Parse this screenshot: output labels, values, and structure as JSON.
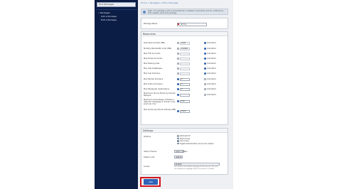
{
  "sidebar": {
    "search_placeholder": "Find Packages",
    "items": [
      "« Packages",
      "Add a Package",
      "Edit a Package"
    ]
  },
  "breadcrumb": [
    "Home",
    "Packages",
    "Edit a Package"
  ],
  "notice": "Note: If a package name is preceded by a reseller's username and an underscore, that reseller owns the package.",
  "package": {
    "label": "Package Name",
    "value": "Jimmy"
  },
  "resources": {
    "title": "Resources",
    "unlimited_label": "Unlimited",
    "rows": [
      {
        "label": "Disk Space Quota (MB)",
        "value": "1000"
      },
      {
        "label": "Monthly Bandwidth Limit (MB)",
        "value": "100000"
      },
      {
        "label": "Max FTP Accounts",
        "value": ""
      },
      {
        "label": "Max Email Accounts",
        "value": ""
      },
      {
        "label": "Max Mailing Lists",
        "value": ""
      },
      {
        "label": "Max SQL Databases",
        "value": ""
      },
      {
        "label": "Max Sub Domains",
        "value": ""
      },
      {
        "label": "Max Parked Domains",
        "value": "0"
      },
      {
        "label": "Max Addon Domains",
        "value": "0"
      },
      {
        "label": "Max Passenger Applications",
        "value": "0"
      },
      {
        "label": "Maximum Hourly Email by Domain Relayed",
        "value": ""
      },
      {
        "label": "Maximum percentage of failed or deferred messages a domain may send per hour",
        "value": "100"
      },
      {
        "label": "Max Quota per Email Address (MB)",
        "value": "1024"
      }
    ]
  },
  "settings": {
    "title": "Settings",
    "options_label": "Options",
    "options": [
      "Dedicated IP",
      "Shell Access",
      "CGI Access",
      "Digest Authentication at account creation"
    ],
    "theme_label": "cPanel Theme",
    "theme_value": "paper_lantern",
    "feature_list_label": "Feature List",
    "feature_list_value": "default",
    "locale_label": "Locale",
    "locale_value": "English",
    "locale_note": "This locale is the default language of the account. The user can change the language after the account is created."
  },
  "save_label": "Add",
  "colors": {
    "sidebar": "#0b1d44",
    "accent": "#2f63b8",
    "highlight": "#d2171d"
  }
}
